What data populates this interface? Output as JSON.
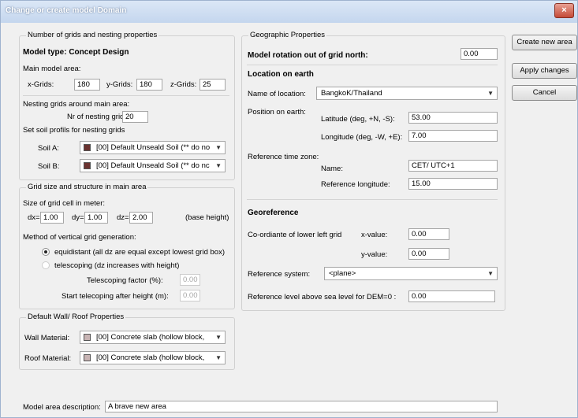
{
  "window": {
    "title": "Change or create model Domain",
    "close": "×"
  },
  "grids": {
    "legend": "Number of grids and nesting properties",
    "model_type": "Model type: Concept Design",
    "main_area_label": "Main model area:",
    "x_label": "x-Grids:",
    "x_value": "180",
    "y_label": "y-Grids:",
    "y_value": "180",
    "z_label": "z-Grids:",
    "z_value": "25",
    "nesting_label": "Nesting grids around main area:",
    "nr_label": "Nr of nesting grids:",
    "nr_value": "20",
    "soil_profiles_label": "Set soil profils for nesting grids",
    "soil_a_label": "Soil A:",
    "soil_a_value": "[00] Default Unseald Soil (** do no",
    "soil_b_label": "Soil B:",
    "soil_b_value": "[00] Default Unseald Soil (** do nc",
    "soil_color": "#6b3330"
  },
  "gridsize": {
    "legend": "Grid size and structure in main area",
    "cell_label": "Size of grid cell in meter:",
    "dx_label": "dx=",
    "dx_value": "1.00",
    "dy_label": "dy=",
    "dy_value": "1.00",
    "dz_label": "dz=",
    "dz_value": "2.00",
    "base_label": "(base height)",
    "method_label": "Method of vertical grid generation:",
    "equidistant_label": "equidistant (all dz are equal except lowest grid box)",
    "telescoping_label": "telescoping (dz increases with height)",
    "factor_label": "Telescoping factor (%):",
    "factor_value": "0.00",
    "start_label": "Start telecoping after height (m):",
    "start_value": "0.00"
  },
  "wall": {
    "legend": "Default Wall/ Roof Properties",
    "wall_label": "Wall Material:",
    "wall_value": "[00] Concrete slab (hollow block,",
    "roof_label": "Roof Material:",
    "roof_value": "[00] Concrete slab (hollow block,",
    "material_color": "#c8b4b4"
  },
  "geo": {
    "legend": "Geographic Properties",
    "rotation_label": "Model rotation out of grid north:",
    "rotation_value": "0.00",
    "location_heading": "Location on earth",
    "name_label": "Name of location:",
    "name_value": "BangkoK/Thailand",
    "position_label": "Position on earth:",
    "lat_label": "Latitude (deg, +N, -S):",
    "lat_value": "53.00",
    "lon_label": "Longitude (deg, -W, +E):",
    "lon_value": "7.00",
    "tz_label": "Reference time zone:",
    "tzname_label": "Name:",
    "tzname_value": "CET/ UTC+1",
    "reflon_label": "Reference longitude:",
    "reflon_value": "15.00",
    "georef_heading": "Georeference",
    "coord_label": "Co-ordiante of lower left grid",
    "xval_label": "x-value:",
    "xval_value": "0.00",
    "yval_label": "y-value:",
    "yval_value": "0.00",
    "refsys_label": "Reference system:",
    "refsys_value": "<plane>",
    "sealevel_label": "Reference level above sea level for DEM=0 :",
    "sealevel_value": "0.00"
  },
  "buttons": {
    "create": "Create new area",
    "apply": "Apply changes",
    "cancel": "Cancel"
  },
  "description": {
    "label": "Model area description:",
    "value": "A brave new area"
  }
}
